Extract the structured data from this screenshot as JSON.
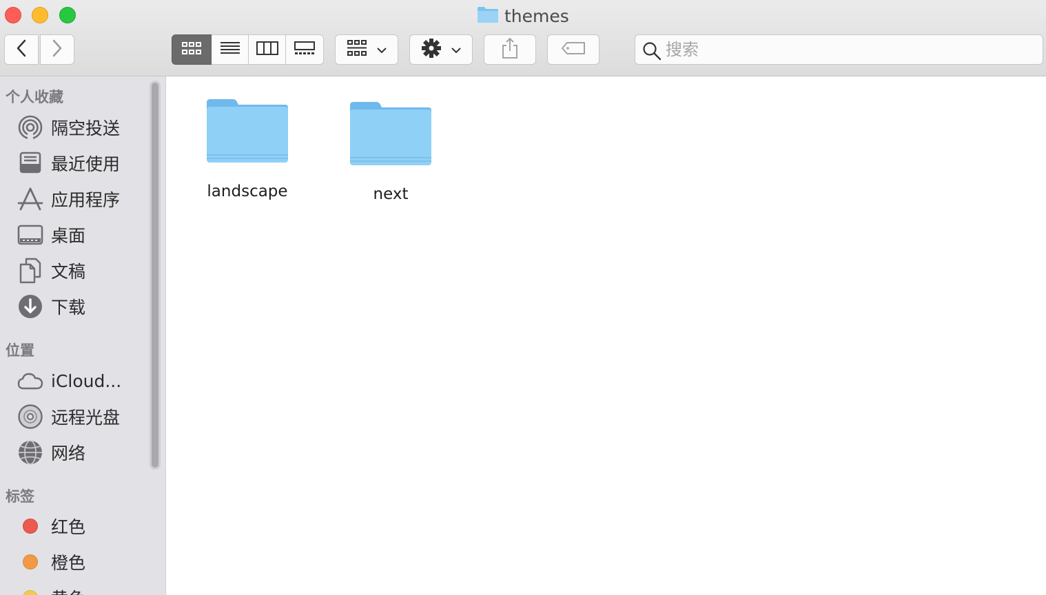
{
  "window": {
    "title": "themes",
    "traffic_lights": {
      "close": "#fc5f57",
      "minimize": "#fdbc2e",
      "zoom": "#28c840"
    }
  },
  "toolbar": {
    "search_placeholder": "搜索",
    "view_modes": [
      "icon-view",
      "list-view",
      "column-view",
      "gallery-view"
    ],
    "active_view": "icon-view"
  },
  "sidebar": {
    "favorites_title": "个人收藏",
    "favorites": [
      {
        "label": "隔空投送",
        "icon": "airdrop-icon"
      },
      {
        "label": "最近使用",
        "icon": "recents-icon"
      },
      {
        "label": "应用程序",
        "icon": "applications-icon"
      },
      {
        "label": "桌面",
        "icon": "desktop-icon"
      },
      {
        "label": "文稿",
        "icon": "documents-icon"
      },
      {
        "label": "下载",
        "icon": "downloads-icon"
      }
    ],
    "locations_title": "位置",
    "locations": [
      {
        "label": "iCloud...",
        "icon": "cloud-icon"
      },
      {
        "label": "远程光盘",
        "icon": "disc-icon"
      },
      {
        "label": "网络",
        "icon": "network-globe-icon"
      }
    ],
    "tags_title": "标签",
    "tags": [
      {
        "label": "红色",
        "color": "#ec5a4f"
      },
      {
        "label": "橙色",
        "color": "#f09a48"
      },
      {
        "label": "黄色",
        "color": "#f3cd4a"
      }
    ]
  },
  "files": [
    {
      "name": "landscape",
      "kind": "folder"
    },
    {
      "name": "next",
      "kind": "folder"
    }
  ]
}
